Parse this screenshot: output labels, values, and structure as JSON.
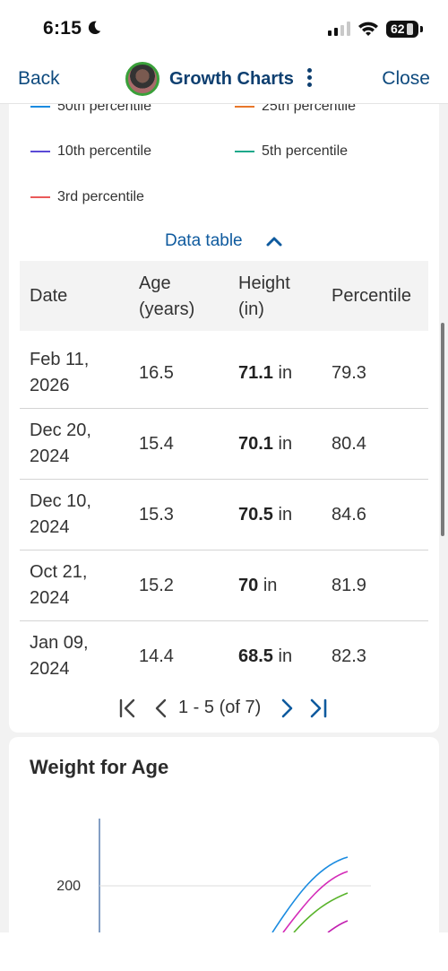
{
  "status": {
    "time": "6:15",
    "battery": "62"
  },
  "nav": {
    "back": "Back",
    "title": "Growth Charts",
    "close": "Close"
  },
  "legend": [
    {
      "label": "50th percentile",
      "color": "#1a8be0"
    },
    {
      "label": "25th percentile",
      "color": "#e8772a"
    },
    {
      "label": "10th percentile",
      "color": "#5b4ad6"
    },
    {
      "label": "5th percentile",
      "color": "#1ca88a"
    },
    {
      "label": "3rd percentile",
      "color": "#ea5a5a"
    }
  ],
  "table": {
    "toggle_label": "Data table",
    "headers": {
      "date": "Date",
      "age_line1": "Age",
      "age_line2": "(years)",
      "height_line1": "Height",
      "height_line2": "(in)",
      "percentile": "Percentile"
    },
    "unit": "in",
    "rows": [
      {
        "date_line1": "Feb 11,",
        "date_line2": "2026",
        "age": "16.5",
        "height": "71.1",
        "percentile": "79.3"
      },
      {
        "date_line1": "Dec 20,",
        "date_line2": "2024",
        "age": "15.4",
        "height": "70.1",
        "percentile": "80.4"
      },
      {
        "date_line1": "Dec 10,",
        "date_line2": "2024",
        "age": "15.3",
        "height": "70.5",
        "percentile": "84.6"
      },
      {
        "date_line1": "Oct 21,",
        "date_line2": "2024",
        "age": "15.2",
        "height": "70",
        "percentile": "81.9"
      },
      {
        "date_line1": "Jan 09,",
        "date_line2": "2024",
        "age": "14.4",
        "height": "68.5",
        "percentile": "82.3"
      }
    ],
    "pagination": "1 - 5 (of 7)"
  },
  "weight_chart": {
    "title": "Weight for Age",
    "y_tick": "200"
  },
  "chart_data": {
    "type": "line",
    "title": "Weight for Age",
    "xlabel": "",
    "ylabel": "",
    "y_ticks": [
      200
    ],
    "series": [
      {
        "color": "#1a8be0"
      },
      {
        "color": "#d42bb8"
      },
      {
        "color": "#58b32a"
      },
      {
        "color": "#c21fb0"
      }
    ]
  }
}
